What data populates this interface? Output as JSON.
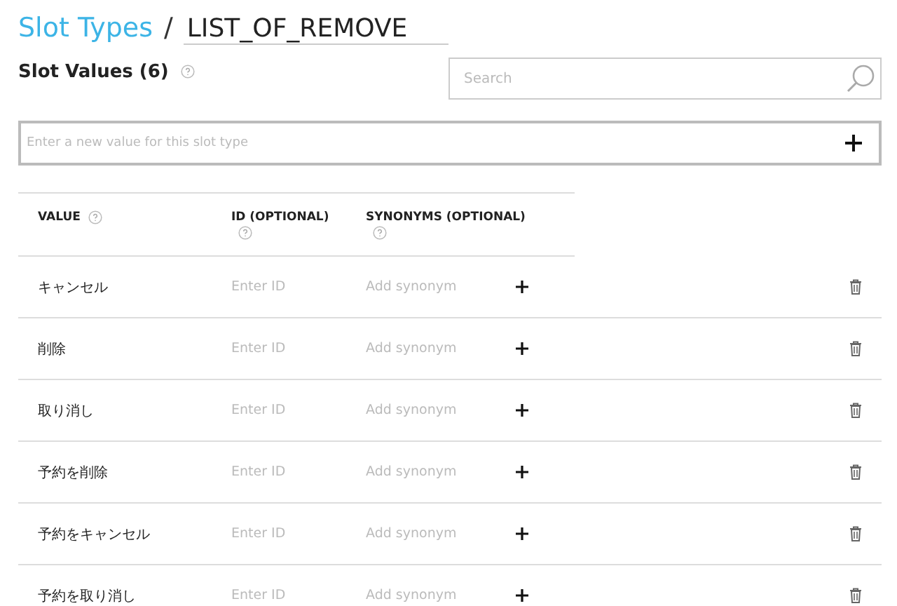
{
  "breadcrumb": {
    "link": "Slot Types",
    "separator": "/",
    "name": "LIST_OF_REMOVE"
  },
  "section": {
    "title": "Slot Values (6)"
  },
  "search": {
    "placeholder": "Search"
  },
  "new_value": {
    "placeholder": "Enter a new value for this slot type"
  },
  "table": {
    "columns": [
      "VALUE",
      "ID (OPTIONAL)",
      "SYNONYMS (OPTIONAL)"
    ],
    "rows": [
      {
        "value": "キャンセル",
        "id_placeholder": "Enter ID",
        "synonym_placeholder": "Add synonym"
      },
      {
        "value": "削除",
        "id_placeholder": "Enter ID",
        "synonym_placeholder": "Add synonym"
      },
      {
        "value": "取り消し",
        "id_placeholder": "Enter ID",
        "synonym_placeholder": "Add synonym"
      },
      {
        "value": "予約を削除",
        "id_placeholder": "Enter ID",
        "synonym_placeholder": "Add synonym"
      },
      {
        "value": "予約をキャンセル",
        "id_placeholder": "Enter ID",
        "synonym_placeholder": "Add synonym"
      },
      {
        "value": "予約を取り消し",
        "id_placeholder": "Enter ID",
        "synonym_placeholder": "Add synonym"
      }
    ]
  }
}
